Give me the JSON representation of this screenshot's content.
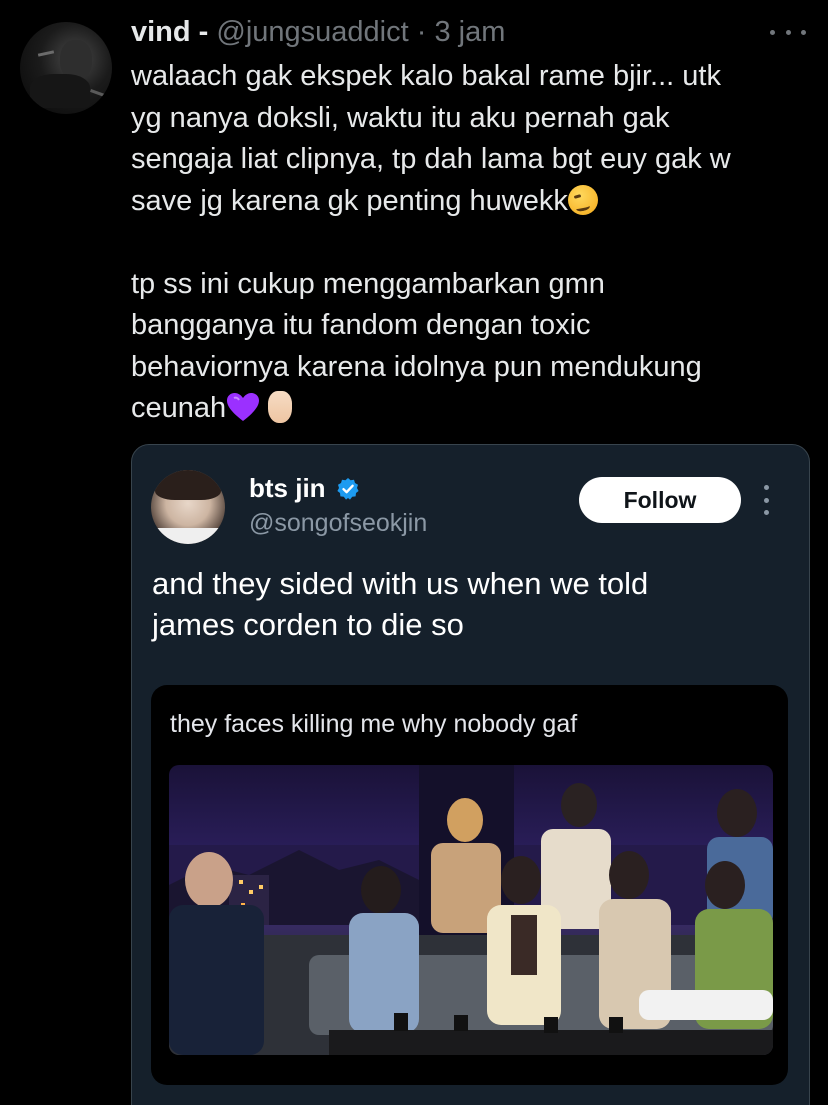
{
  "tweet": {
    "author_name": "vind -",
    "handle": "@jungsuaddict",
    "separator": "·",
    "time": "3 jam",
    "more_icon": "more-horizontal-icon",
    "body_para1_line1": "walaach gak ekspek kalo bakal rame bjir... utk",
    "body_para1_line2": "yg nanya doksli, waktu itu aku pernah gak",
    "body_para1_line3": "sengaja liat clipnya, tp dah lama bgt euy gak w",
    "body_para1_line4": "save jg karena gk penting huwekk",
    "emoji_1": "woozy-face-emoji",
    "body_para2_line1": "tp ss ini cukup menggambarkan gmn",
    "body_para2_line2": "bangganya itu fandom dengan toxic",
    "body_para2_line3": "behaviornya karena idolnya pun mendukung",
    "body_para2_line4": "ceunah",
    "emoji_2": "purple-heart-emoji",
    "emoji_3": "hand-with-index-finger-and-thumb-crossed-emoji"
  },
  "quote": {
    "name": "bts jin",
    "verified_icon": "verified-badge-icon",
    "handle": "@songofseokjin",
    "follow_label": "Follow",
    "more_icon": "more-vertical-icon",
    "text_line1": "and they sided with us when we told",
    "text_line2": "james corden to die so",
    "meme": {
      "caption": "they faces killing me why nobody gaf",
      "image": "talk-show-photo"
    }
  },
  "colors": {
    "background": "#000000",
    "text_primary": "#e7e9ea",
    "text_secondary": "#71767b",
    "card_bg": "#15202b",
    "card_border": "#38444d",
    "verified": "#1d9bf0",
    "heart": "#9b30ff"
  }
}
